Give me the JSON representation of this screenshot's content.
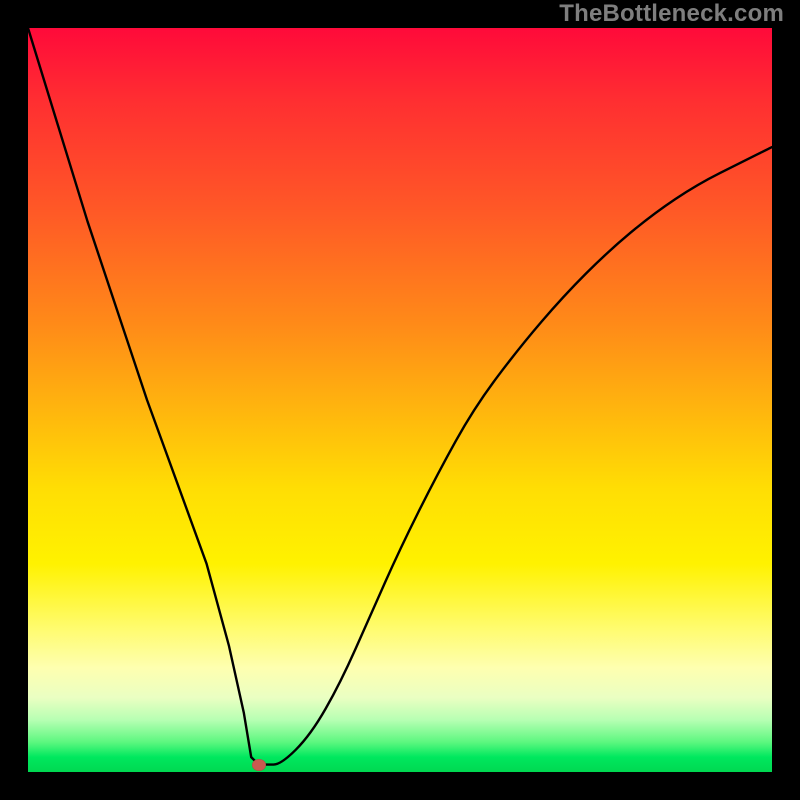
{
  "watermark": "TheBottleneck.com",
  "colors": {
    "frame": "#000000",
    "curve_stroke": "#000000",
    "marker": "#c85a50",
    "gradient_stops": [
      "#ff0a3a",
      "#ff5a26",
      "#ffb80d",
      "#fff200",
      "#feffb0",
      "#00d851"
    ]
  },
  "chart_data": {
    "type": "line",
    "title": "",
    "xlabel": "",
    "ylabel": "",
    "xlim": [
      0,
      100
    ],
    "ylim": [
      0,
      100
    ],
    "grid": false,
    "legend": false,
    "annotations": [
      {
        "kind": "marker",
        "x": 31,
        "y": 1,
        "color": "#c85a50"
      }
    ],
    "series": [
      {
        "name": "bottleneck-curve",
        "x": [
          0,
          4,
          8,
          12,
          16,
          20,
          24,
          27,
          29,
          30,
          31,
          32,
          34,
          38,
          42,
          46,
          50,
          55,
          60,
          66,
          72,
          78,
          84,
          90,
          96,
          100
        ],
        "y": [
          100,
          87,
          74,
          62,
          50,
          39,
          28,
          17,
          8,
          2,
          1,
          1,
          1,
          5,
          12,
          21,
          30,
          40,
          49,
          57,
          64,
          70,
          75,
          79,
          82,
          84
        ]
      }
    ],
    "notes": "x and y are percentages of the plot area (0–100). The curve drops almost linearly from the top-left to a minimum near x≈31, has a tiny flat segment at the bottom, then rises along a concave-down arc toward the upper right. Background is a red→green vertical gradient; black frame surrounds the plot; a small reddish oval marker sits at the curve's minimum."
  }
}
